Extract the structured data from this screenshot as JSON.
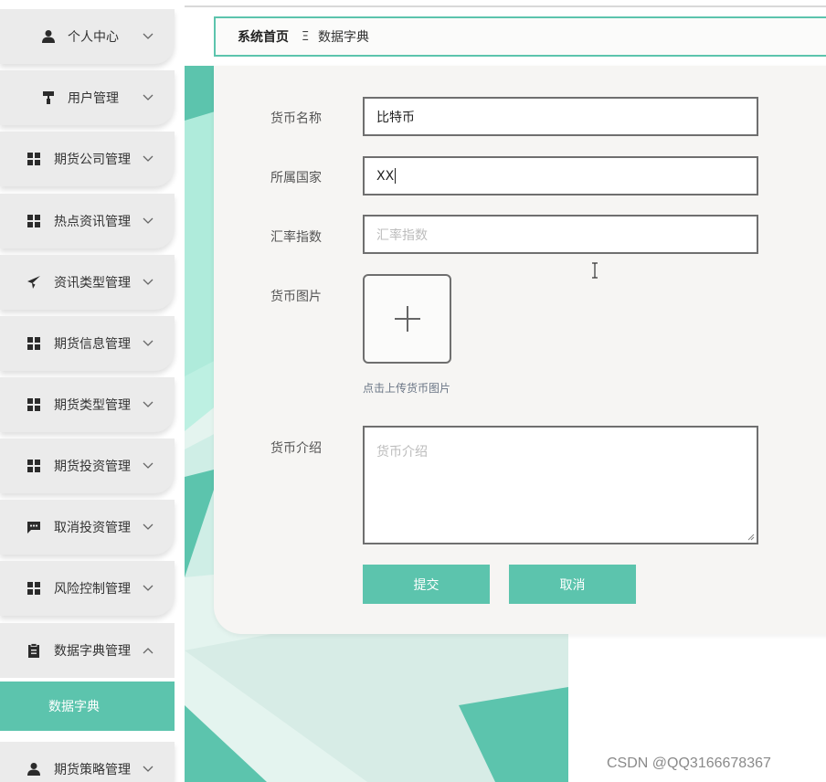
{
  "sidebar": {
    "items": [
      {
        "label": "个人中心",
        "icon": "user-icon",
        "expanded": false
      },
      {
        "label": "用户管理",
        "icon": "paint-roller-icon",
        "expanded": false
      },
      {
        "label": "期货公司管理",
        "icon": "grid-icon",
        "expanded": false
      },
      {
        "label": "热点资讯管理",
        "icon": "grid-icon",
        "expanded": false
      },
      {
        "label": "资讯类型管理",
        "icon": "paper-plane-icon",
        "expanded": false
      },
      {
        "label": "期货信息管理",
        "icon": "grid-icon",
        "expanded": false
      },
      {
        "label": "期货类型管理",
        "icon": "grid-icon",
        "expanded": false
      },
      {
        "label": "期货投资管理",
        "icon": "grid-icon",
        "expanded": false
      },
      {
        "label": "取消投资管理",
        "icon": "comment-icon",
        "expanded": false
      },
      {
        "label": "风险控制管理",
        "icon": "grid-icon",
        "expanded": false
      },
      {
        "label": "数据字典管理",
        "icon": "clipboard-icon",
        "expanded": true
      },
      {
        "label": "期货策略管理",
        "icon": "user-icon",
        "expanded": false
      }
    ],
    "sub_item": {
      "label": "数据字典",
      "active": true
    }
  },
  "breadcrumb": {
    "home": "系统首页",
    "separator": "Ξ",
    "current": "数据字典"
  },
  "form": {
    "currency_name": {
      "label": "货币名称",
      "value": "比特币"
    },
    "country": {
      "label": "所属国家",
      "value": "XX"
    },
    "exchange_rate": {
      "label": "汇率指数",
      "placeholder": "汇率指数",
      "value": ""
    },
    "image": {
      "label": "货币图片",
      "hint": "点击上传货币图片"
    },
    "intro": {
      "label": "货币介绍",
      "placeholder": "货币介绍",
      "value": ""
    },
    "submit_label": "提交",
    "cancel_label": "取消"
  },
  "watermark": "CSDN @QQ3166678367",
  "colors": {
    "accent": "#5cc4ad",
    "sidebar_bg": "#ebebeb",
    "panel_bg": "#f6f5f3",
    "input_border": "#6f6f6f"
  }
}
